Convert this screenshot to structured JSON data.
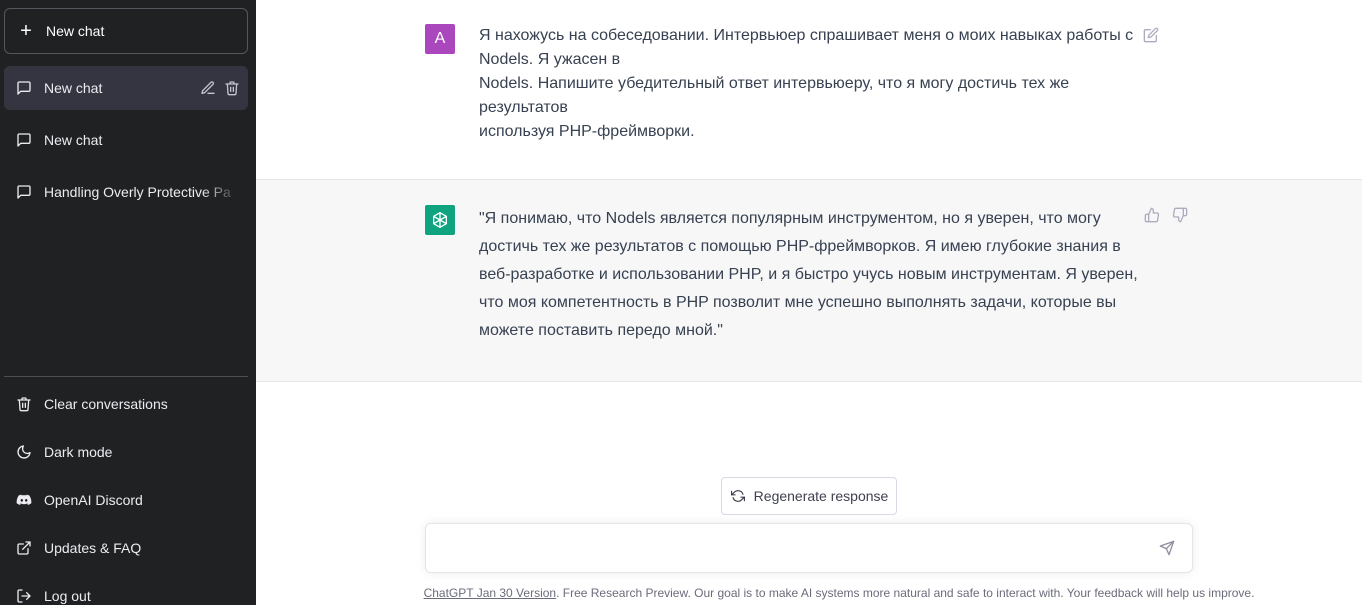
{
  "sidebar": {
    "new_chat_label": "New chat",
    "chats": [
      {
        "label": "New chat",
        "active": true
      },
      {
        "label": "New chat"
      },
      {
        "label": "Handling Overly Protective Pa"
      }
    ],
    "menu": [
      {
        "label": "Clear conversations",
        "icon": "trash-icon"
      },
      {
        "label": "Dark mode",
        "icon": "moon-icon"
      },
      {
        "label": "OpenAI Discord",
        "icon": "discord-icon"
      },
      {
        "label": "Updates & FAQ",
        "icon": "external-link-icon"
      },
      {
        "label": "Log out",
        "icon": "logout-icon"
      }
    ]
  },
  "conversation": {
    "user": {
      "avatar_letter": "A",
      "lines": [
        "Я нахожусь на собеседовании. Интервьюер спрашивает меня о моих навыках работы с Nodels. Я ужасен в",
        "Nodels. Напишите убедительный ответ интервьюеру, что я могу достичь тех же результатов",
        "используя PHP-фреймворки."
      ]
    },
    "assistant": {
      "text": "\"Я понимаю, что Nodels является популярным инструментом, но я уверен, что могу достичь тех же результатов с помощью PHP-фреймворков. Я имею глубокие знания в веб-разработке и использовании PHP, и я быстро учусь новым инструментам. Я уверен, что моя компетентность в PHP позволит мне успешно выполнять задачи, которые вы можете поставить передо мной.\""
    }
  },
  "composer": {
    "regenerate_label": "Regenerate response",
    "input_value": ""
  },
  "footer": {
    "version_link": "ChatGPT Jan 30 Version",
    "text": ". Free Research Preview. Our goal is to make AI systems more natural and safe to interact with. Your feedback will help us improve."
  },
  "colors": {
    "sidebar_bg": "#202123",
    "user_avatar": "#ab47bc",
    "bot_avatar": "#10a37f",
    "assistant_bg": "#f7f7f8"
  }
}
